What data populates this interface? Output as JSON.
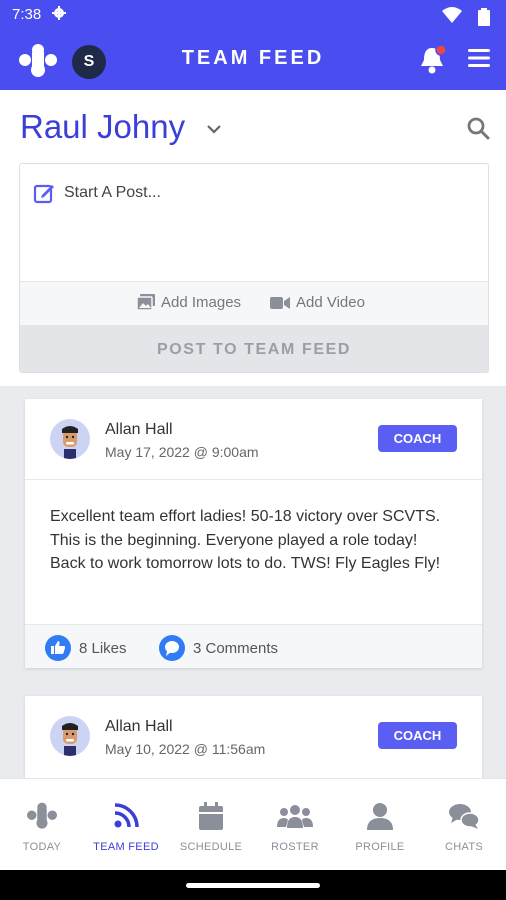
{
  "status": {
    "time": "7:38"
  },
  "appbar": {
    "avatar_letter": "S",
    "title": "TEAM FEED"
  },
  "header": {
    "user_name": "Raul Johny"
  },
  "composer": {
    "placeholder": "Start A Post...",
    "add_images": "Add Images",
    "add_video": "Add Video",
    "post_button": "POST TO TEAM FEED"
  },
  "posts": [
    {
      "author": "Allan Hall",
      "date": "May 17, 2022 @ 9:00am",
      "badge": "COACH",
      "text": "Excellent team effort ladies! 50-18 victory over SCVTS. This is the beginning. Everyone played a role today! Back to work tomorrow lots to do. TWS! Fly Eagles Fly!",
      "likes": "8 Likes",
      "comments": "3 Comments"
    },
    {
      "author": "Allan Hall",
      "date": "May 10, 2022 @ 11:56am",
      "badge": "COACH"
    }
  ],
  "nav": {
    "today": "TODAY",
    "team_feed": "TEAM FEED",
    "schedule": "SCHEDULE",
    "roster": "ROSTER",
    "profile": "PROFILE",
    "chats": "CHATS"
  },
  "colors": {
    "brand": "#4a4df0",
    "accent_text": "#3a3fd8",
    "badge": "#5b5ef2",
    "icon_blue": "#2f7cf4",
    "nav_gray": "#8a8f99"
  }
}
